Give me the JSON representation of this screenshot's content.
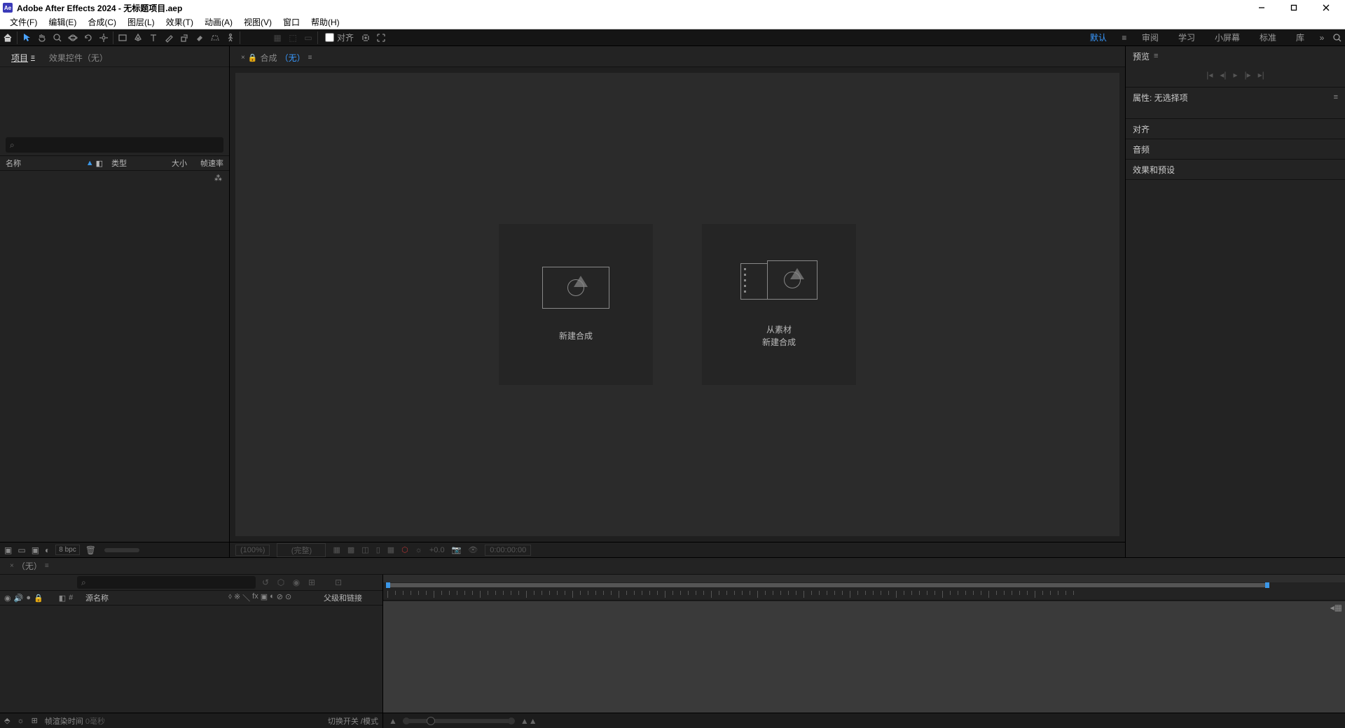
{
  "title": "Adobe After Effects 2024 - 无标题项目.aep",
  "logo": "Ae",
  "menu": {
    "file": "文件(F)",
    "edit": "编辑(E)",
    "comp": "合成(C)",
    "layer": "图层(L)",
    "effect": "效果(T)",
    "anim": "动画(A)",
    "view": "视图(V)",
    "window": "窗口",
    "help": "帮助(H)"
  },
  "toolbar": {
    "align": "对齐"
  },
  "workspaces": {
    "default": "默认",
    "review": "审阅",
    "learn": "学习",
    "small": "小屏幕",
    "standard": "标准",
    "lib": "库"
  },
  "project": {
    "tab_project": "项目",
    "tab_effects": "效果控件（无）",
    "col_name": "名称",
    "col_type": "类型",
    "col_size": "大小",
    "col_fps": "帧速率",
    "bpc": "8 bpc"
  },
  "composition": {
    "tab_prefix": "合成",
    "tab_none": "（无）",
    "card_new": "新建合成",
    "card_from1": "从素材",
    "card_from2": "新建合成",
    "zoom": "(100%)",
    "res": "(完整)",
    "exp": "+0.0",
    "tc": "0:00:00:00"
  },
  "right": {
    "preview": "预览",
    "properties": "属性: 无选择项",
    "align": "对齐",
    "audio": "音频",
    "effects": "效果和预设"
  },
  "timeline": {
    "tab": "（无）",
    "src": "源名称",
    "switches_hint": "",
    "parent": "父级和链接",
    "render": "帧渲染时间",
    "render_val": " 0毫秒",
    "toggle": "切换开关 /模式"
  }
}
